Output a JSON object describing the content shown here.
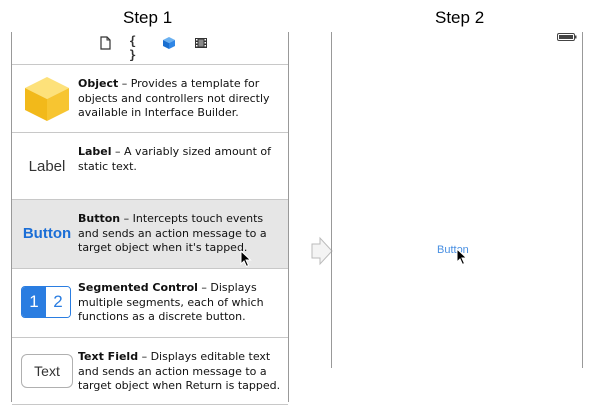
{
  "steps": {
    "step1_title": "Step 1",
    "step2_title": "Step 2"
  },
  "library": {
    "tabs": [
      {
        "name": "file-template-icon"
      },
      {
        "name": "code-snippet",
        "label": "{ }"
      },
      {
        "name": "object-library-icon",
        "active": true
      },
      {
        "name": "media-library-icon"
      }
    ],
    "items": [
      {
        "title": "Object",
        "description": " – Provides a template for objects and controllers not directly available in Interface Builder."
      },
      {
        "title": "Label",
        "thumb": "Label",
        "description": " – A variably sized amount of static text."
      },
      {
        "title": "Button",
        "thumb": "Button",
        "description": " – Intercepts touch events and sends an action message to a target object when it's tapped.",
        "selected": true
      },
      {
        "title": "Segmented Control",
        "segments": [
          "1",
          "2"
        ],
        "description": " – Displays multiple segments, each of which functions as a discrete button."
      },
      {
        "title": "Text Field",
        "thumb": "Text",
        "description": " – Displays editable text and sends an action message to a target object when Return is tapped."
      }
    ]
  },
  "canvas": {
    "button_label": "Button"
  },
  "colors": {
    "accent": "#2a7de1",
    "selected_row": "#e6e6e6",
    "cube_yellow": "#f7c531"
  }
}
